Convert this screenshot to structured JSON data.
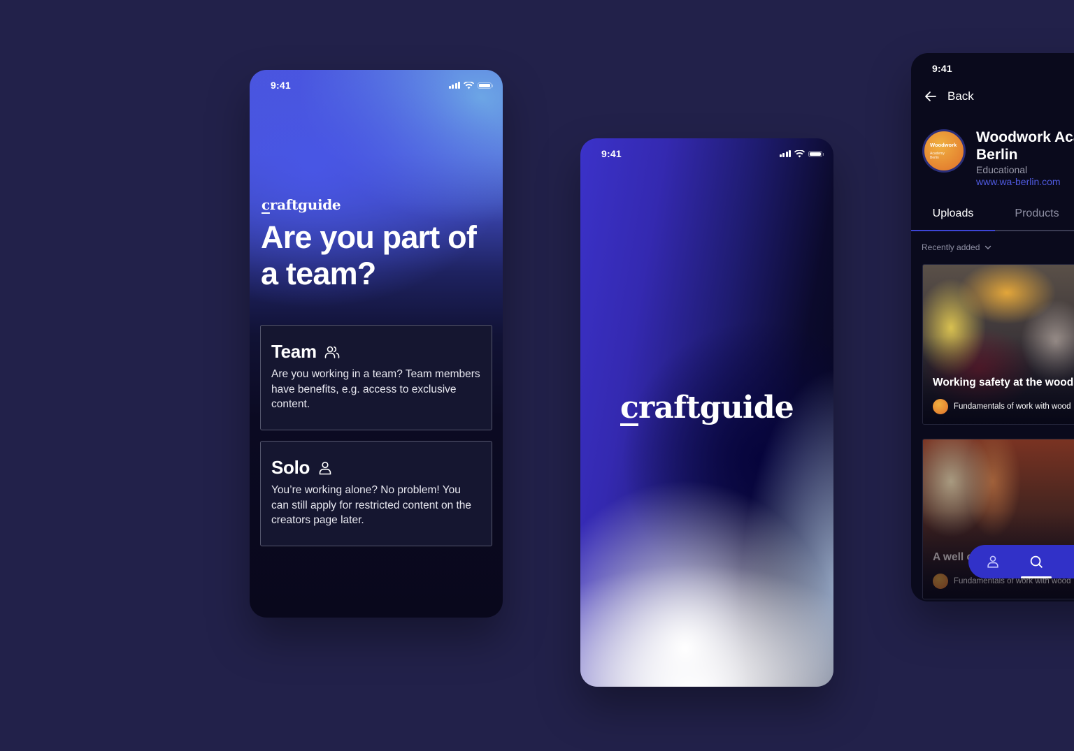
{
  "status_bar": {
    "time": "9:41"
  },
  "screen_team": {
    "brand": {
      "first_letter": "c",
      "rest": "raftguide"
    },
    "headline": "Are you part of a team?",
    "options": [
      {
        "title": "Team",
        "icon": "users-icon",
        "description": "Are you working in a team? Team members have benefits, e.g. access to exclusive content."
      },
      {
        "title": "Solo",
        "icon": "user-icon",
        "description": "You’re working alone? No problem! You can still apply for restricted content on the creators page later."
      }
    ]
  },
  "screen_splash": {
    "brand": {
      "first_letter": "c",
      "rest": "raftguide"
    }
  },
  "screen_profile": {
    "back_label": "Back",
    "avatar": {
      "line1": "Woodwork",
      "line2": "Academy",
      "line3": "Berlin"
    },
    "name": "Woodwork Academy Berlin",
    "name_line1": "Woodwork Academy",
    "name_line2": "Berlin",
    "category": "Educational",
    "url": "www.wa-berlin.com",
    "tabs": [
      {
        "label": "Uploads",
        "active": true
      },
      {
        "label": "Products",
        "active": false
      }
    ],
    "sort_label": "Recently added",
    "uploads": [
      {
        "title": "Working safety at the woodshop",
        "subtitle": "Fundamentals of work with wood"
      },
      {
        "title": "A well organized workshop",
        "subtitle": "Fundamentals of work with wood"
      }
    ],
    "nav": [
      {
        "icon": "profile-icon",
        "active": false
      },
      {
        "icon": "search-icon",
        "active": true
      },
      {
        "icon": "more-icon",
        "active": false
      }
    ]
  },
  "colors": {
    "background": "#22214a",
    "accent": "#3d45d6",
    "link": "#4f5ae0",
    "nav_bar": "#3131c8"
  }
}
